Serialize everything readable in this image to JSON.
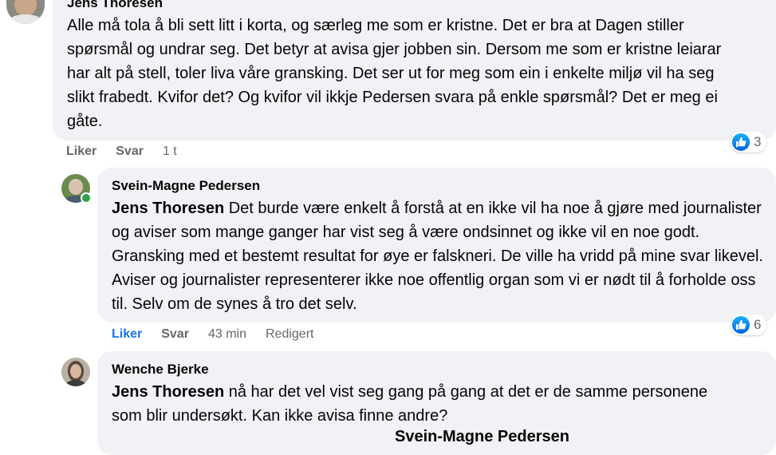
{
  "comments": [
    {
      "author": "Jens Thoresen",
      "text": "Alle må tola å bli sett litt i korta, og særleg me som er kristne. Det er bra at Dagen stiller spørsmål og undrar seg. Det betyr at avisa gjer jobben sin. Dersom me som er kristne leiarar har alt på stell, toler liva våre gransking. Det ser ut for meg som ein i enkelte miljø vil ha seg slikt frabedt. Kvifor det? Og kvifor vil ikkje Pedersen svara på enkle spørsmål? Det er meg ei gåte.",
      "actions": {
        "like": "Liker",
        "reply": "Svar",
        "time": "1 t"
      },
      "reactions": {
        "icon": "like-icon",
        "count": "3"
      }
    },
    {
      "author": "Svein-Magne Pedersen",
      "mention": "Jens Thoresen",
      "text": " Det burde være enkelt å forstå at en ikke vil ha noe å gjøre med journalister og aviser som mange ganger har vist seg å være ondsinnet og ikke vil en noe godt. Gransking med et bestemt resultat for øye er falskneri. De ville ha vridd på mine svar likevel. Aviser og journalister representerer ikke noe offentlig organ som vi er nødt til å forholde oss til. Selv om de synes å tro det selv.",
      "actions": {
        "like": "Liker",
        "reply": "Svar",
        "time": "43 min",
        "edited": "Redigert"
      },
      "reactions": {
        "icon": "like-icon",
        "count": "6"
      },
      "online": true
    },
    {
      "author": "Wenche Bjerke",
      "mention": "Jens Thoresen",
      "text": " nå har det vel vist seg gang på gang at det er de samme personene som blir undersøkt. Kan ikke avisa finne andre?",
      "partial_line_mention": "Svein-Magne Pedersen"
    }
  ],
  "colors": {
    "bubble": "#f0f2f5",
    "liked": "#1b74e4",
    "meta": "#65676b",
    "like_icon": "#0866ff"
  }
}
